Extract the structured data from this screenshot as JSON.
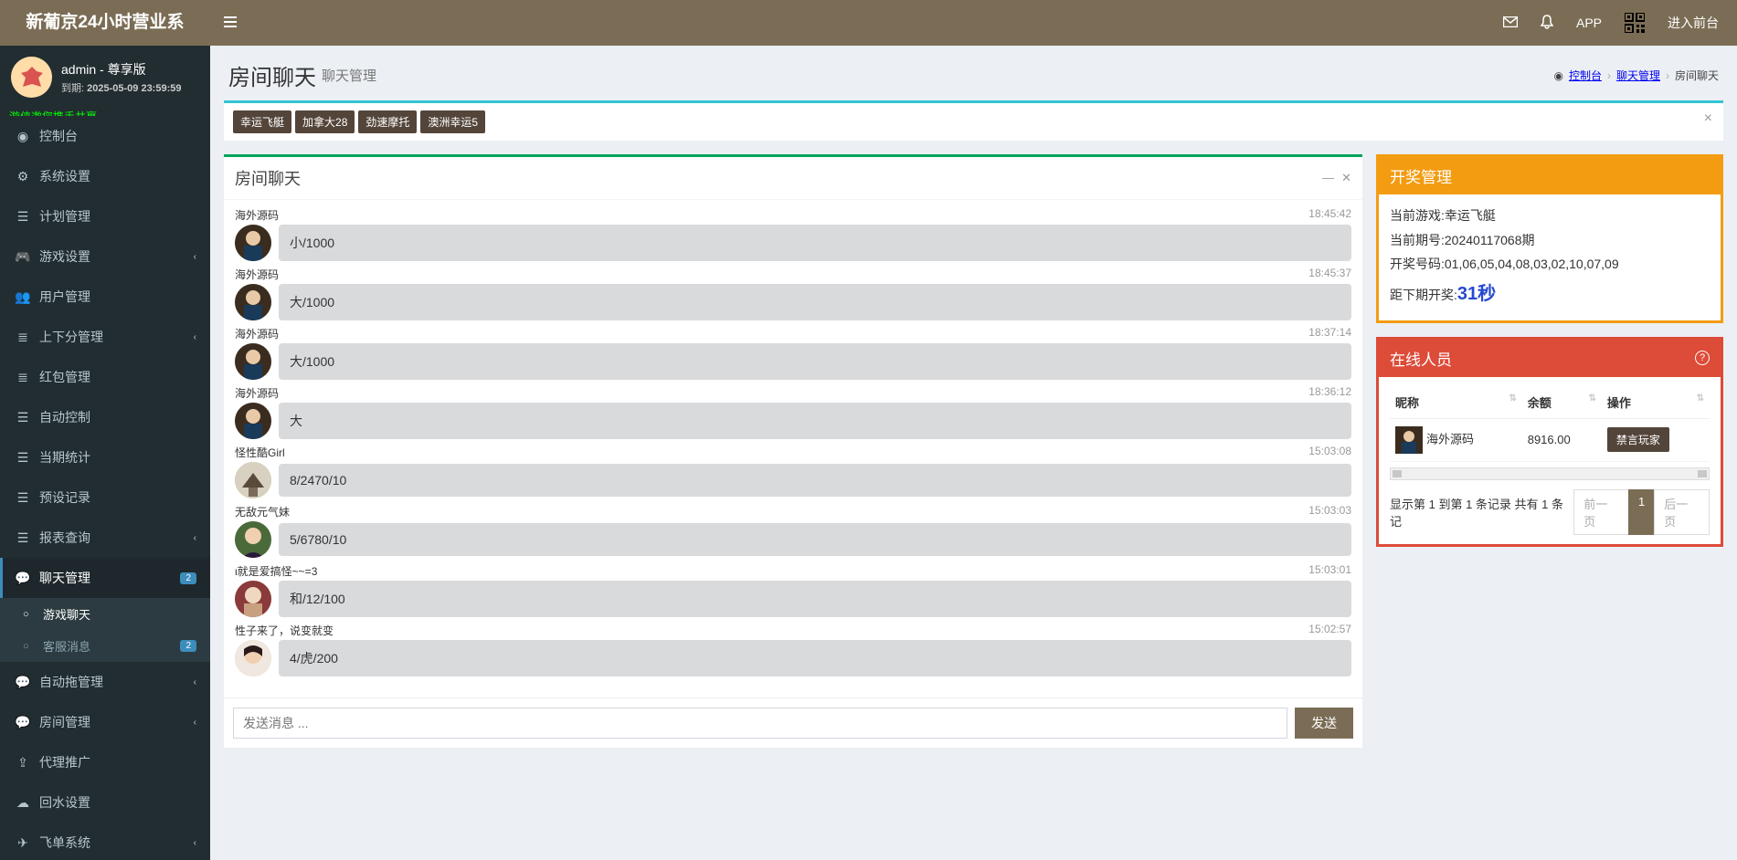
{
  "header": {
    "logo": "新葡京24小时营业系",
    "app_label": "APP",
    "enter_front": "进入前台"
  },
  "user": {
    "name": "admin - 尊享版",
    "expire_label": "到期:",
    "expire_value": "2025-05-09 23:59:59",
    "marquee": "游侠邀您携手共赢"
  },
  "menu": {
    "console": "控制台",
    "system": "系统设置",
    "plan": "计划管理",
    "game": "游戏设置",
    "users": "用户管理",
    "updown": "上下分管理",
    "redpack": "红包管理",
    "auto": "自动控制",
    "period": "当期统计",
    "preset": "预设记录",
    "report": "报表查询",
    "chat": "聊天管理",
    "chat_badge": "2",
    "chat_sub_game": "游戏聊天",
    "chat_sub_service": "客服消息",
    "chat_sub_service_badge": "2",
    "autotow": "自动拖管理",
    "room": "房间管理",
    "agent": "代理推广",
    "rebate": "回水设置",
    "flyorder": "飞单系统"
  },
  "page": {
    "title": "房间聊天",
    "subtitle": "聊天管理",
    "crumb1": "控制台",
    "crumb2": "聊天管理",
    "crumb3": "房间聊天"
  },
  "tags": [
    "幸运飞艇",
    "加拿大28",
    "劲速摩托",
    "澳洲幸运5"
  ],
  "chatbox": {
    "title": "房间聊天",
    "placeholder": "发送消息 ...",
    "send": "发送"
  },
  "messages": [
    {
      "name": "海外源码",
      "time": "18:45:42",
      "text": "小/1000",
      "av": 0
    },
    {
      "name": "海外源码",
      "time": "18:45:37",
      "text": "大/1000",
      "av": 0
    },
    {
      "name": "海外源码",
      "time": "18:37:14",
      "text": "大/1000",
      "av": 0
    },
    {
      "name": "海外源码",
      "time": "18:36:12",
      "text": "大",
      "av": 0
    },
    {
      "name": "怪性酷Girl",
      "time": "15:03:08",
      "text": "8/2470/10",
      "av": 1
    },
    {
      "name": "无敌元气妹",
      "time": "15:03:03",
      "text": "5/6780/10",
      "av": 2
    },
    {
      "name": "ι就是爱搞怪~~=3",
      "time": "15:03:01",
      "text": "和/12/100",
      "av": 3
    },
    {
      "name": "性子来了，说变就变",
      "time": "15:02:57",
      "text": "4/虎/200",
      "av": 4
    }
  ],
  "lottery": {
    "title": "开奖管理",
    "game_label": "当前游戏:",
    "game_value": "幸运飞艇",
    "period_label": "当前期号:",
    "period_value": "20240117068期",
    "result_label": "开奖号码:",
    "result_value": "01,06,05,04,08,03,02,10,07,09",
    "next_label": "距下期开奖:",
    "countdown": "31秒"
  },
  "online": {
    "title": "在线人员",
    "col_nick": "昵称",
    "col_balance": "余额",
    "col_action": "操作",
    "rows": [
      {
        "nick": "海外源码",
        "balance": "8916.00",
        "action": "禁言玩家"
      }
    ],
    "info": "显示第 1 到第 1 条记录 共有 1 条记",
    "prev": "前一页",
    "page": "1",
    "next": "后一页"
  }
}
